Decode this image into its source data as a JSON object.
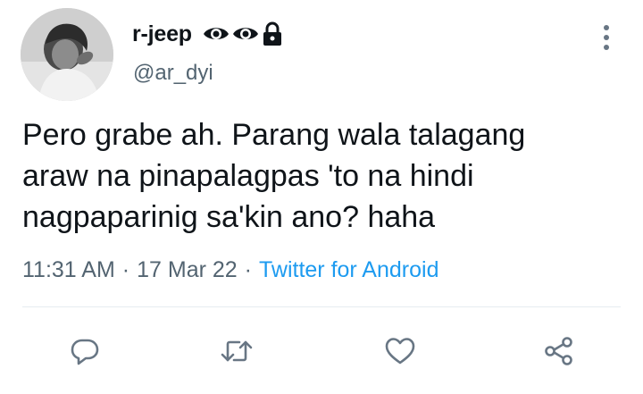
{
  "tweet": {
    "display_name": "r-jeep",
    "handle": "@ar_dyi",
    "badges": [
      "eye-icon",
      "eye-icon",
      "lock-icon"
    ],
    "text_lines": [
      "Pero grabe ah. Parang wala talagang",
      "araw na pinapalagpas 'to na hindi",
      "nagpaparinig sa'kin ano? haha"
    ],
    "time": "11:31 AM",
    "date": "17 Mar 22",
    "separator": "·",
    "source": "Twitter for Android"
  },
  "actions": [
    "reply-icon",
    "retweet-icon",
    "like-icon",
    "share-icon"
  ],
  "colors": {
    "text": "#0f1419",
    "secondary": "#536471",
    "link": "#1d9bf0",
    "icon": "#687684",
    "divider": "#e6ecf0"
  }
}
